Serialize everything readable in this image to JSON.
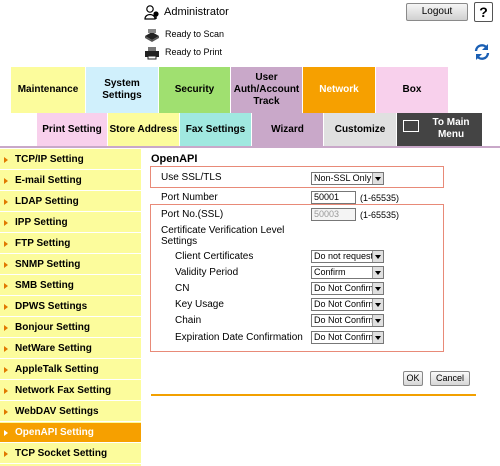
{
  "header": {
    "user_name": "Administrator",
    "logout_label": "Logout",
    "help_label": "?",
    "status_scan": "Ready to Scan",
    "status_print": "Ready to Print"
  },
  "main_tabs": [
    {
      "label": "Maintenance",
      "color": "#fcfc9c"
    },
    {
      "label": "System Settings",
      "color": "#d0f0fc"
    },
    {
      "label": "Security",
      "color": "#a0e070"
    },
    {
      "label": "User Auth/Account Track",
      "color": "#c9a8c9"
    },
    {
      "label": "Network",
      "color": "#f6a000",
      "active": true
    },
    {
      "label": "Box",
      "color": "#f8d0ec"
    }
  ],
  "sub_tabs": [
    {
      "label": "Print Setting",
      "color": "#f8d0ec"
    },
    {
      "label": "Store Address",
      "color": "#fcfc9c"
    },
    {
      "label": "Fax Settings",
      "color": "#a0e8e0"
    },
    {
      "label": "Wizard",
      "color": "#c9a8c9"
    },
    {
      "label": "Customize",
      "color": "#e0e0e0"
    },
    {
      "label": "To Main Menu",
      "color": "#444444"
    }
  ],
  "sidebar": {
    "items": [
      "TCP/IP Setting",
      "E-mail Setting",
      "LDAP Setting",
      "IPP Setting",
      "FTP Setting",
      "SNMP Setting",
      "SMB Setting",
      "DPWS Settings",
      "Bonjour Setting",
      "NetWare Setting",
      "AppleTalk Setting",
      "Network Fax Setting",
      "WebDAV Settings",
      "OpenAPI Setting",
      "TCP Socket Setting"
    ],
    "active_item": "OpenAPI Setting"
  },
  "page": {
    "title": "OpenAPI",
    "use_ssl_label": "Use SSL/TLS",
    "use_ssl_value": "Non-SSL Only",
    "port_label": "Port Number",
    "port_value": "50001",
    "port_range": "(1-65535)",
    "ssl_port_label": "Port No.(SSL)",
    "ssl_port_value": "50003",
    "ssl_port_range": "(1-65535)",
    "cert_heading": "Certificate Verification Level Settings",
    "cert_rows": [
      {
        "label": "Client Certificates",
        "value": "Do not request"
      },
      {
        "label": "Validity Period",
        "value": "Confirm"
      },
      {
        "label": "CN",
        "value": "Do Not Confirm"
      },
      {
        "label": "Key Usage",
        "value": "Do Not Confirm"
      },
      {
        "label": "Chain",
        "value": "Do Not Confirm"
      },
      {
        "label": "Expiration Date Confirmation",
        "value": "Do Not Confirm"
      }
    ],
    "ok_label": "OK",
    "cancel_label": "Cancel"
  }
}
